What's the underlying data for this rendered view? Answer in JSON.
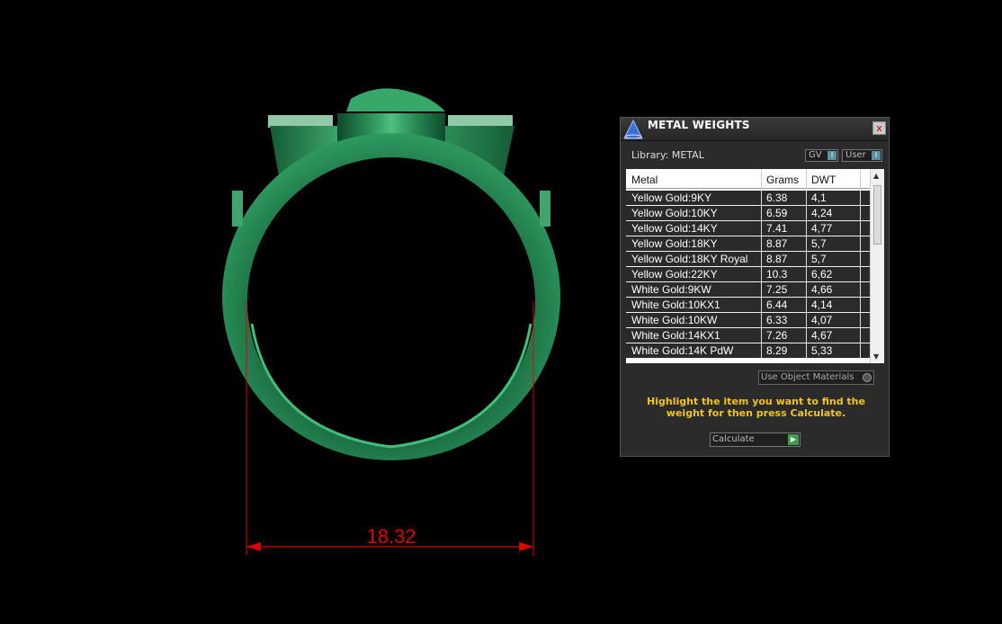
{
  "viewport": {
    "dimension_value": "18.32",
    "dimension_color": "#e00000",
    "ring_color": "#1d7a4a"
  },
  "panel": {
    "title": "METAL WEIGHTS",
    "close_label": "x",
    "library_label": "Library: METAL",
    "toggle_gv": "GV",
    "toggle_user": "User",
    "toggle_knob": "I",
    "columns": [
      "Metal",
      "Grams",
      "DWT"
    ],
    "rows": [
      {
        "metal": "Yellow Gold:9KY",
        "grams": "6.38",
        "dwt": "4,1"
      },
      {
        "metal": "Yellow Gold:10KY",
        "grams": "6.59",
        "dwt": "4,24"
      },
      {
        "metal": "Yellow Gold:14KY",
        "grams": "7.41",
        "dwt": "4,77"
      },
      {
        "metal": "Yellow Gold:18KY",
        "grams": "8.87",
        "dwt": "5,7"
      },
      {
        "metal": "Yellow Gold:18KY Royal",
        "grams": "8.87",
        "dwt": "5,7"
      },
      {
        "metal": "Yellow Gold:22KY",
        "grams": "10.3",
        "dwt": "6,62"
      },
      {
        "metal": "White Gold:9KW",
        "grams": "7.25",
        "dwt": "4,66"
      },
      {
        "metal": "White Gold:10KX1",
        "grams": "6.44",
        "dwt": "4,14"
      },
      {
        "metal": "White Gold:10KW",
        "grams": "6.33",
        "dwt": "4,07"
      },
      {
        "metal": "White Gold:14KX1",
        "grams": "7.26",
        "dwt": "4,67"
      },
      {
        "metal": "White Gold:14K PdW",
        "grams": "8.29",
        "dwt": "5,33"
      }
    ],
    "use_object_materials": "Use Object Materials",
    "hint": "Highlight the item you want to find the weight for then press Calculate.",
    "calculate_label": "Calculate",
    "accent_color": "#f0c419"
  }
}
